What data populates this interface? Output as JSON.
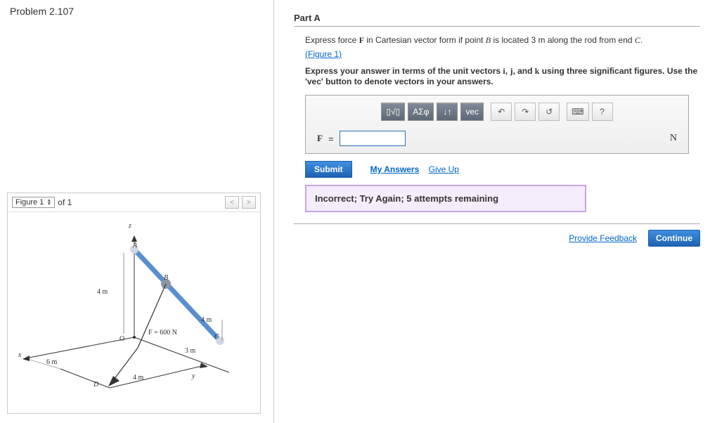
{
  "problem": {
    "title": "Problem 2.107"
  },
  "figure": {
    "selector": "Figure 1",
    "count_label": "of 1",
    "labels": {
      "z": "z",
      "A": "A",
      "B": "B",
      "O": "O",
      "C": "C",
      "D": "D",
      "x": "x",
      "y": "y",
      "dim4m_top": "4 m",
      "dim4m_right": "4 m",
      "dim3m": "3 m",
      "dim4m_bottom": "4 m",
      "dim6m": "6 m",
      "force": "F = 600 N"
    }
  },
  "partA": {
    "heading": "Part A",
    "prompt_pre": "Express force ",
    "F": "F",
    "prompt_mid": " in Cartesian vector form if point ",
    "B": "B",
    "prompt_post": " is located 3 m along the rod from end ",
    "C": "C",
    "period": ".",
    "figure_link": "(Figure 1)",
    "instruction_pre": "Express your answer in terms of the unit vectors ",
    "i": "i",
    "comma1": ", ",
    "j": "j",
    "comma2": ", and ",
    "k": "k",
    "instruction_post": " using three significant figures. Use the 'vec' button to denote vectors in your answers."
  },
  "toolbar": {
    "template": "▯√▯",
    "greek": "ΑΣφ",
    "updown": "↓↑",
    "vec": "vec",
    "undo": "↶",
    "redo": "↷",
    "reset": "↺",
    "keyboard": "⌨",
    "help": "?"
  },
  "answer": {
    "lhs": "F",
    "equals": "=",
    "value": "",
    "unit": "N"
  },
  "actions": {
    "submit": "Submit",
    "my_answers": "My Answers",
    "give_up": "Give Up",
    "provide_feedback": "Provide Feedback",
    "continue": "Continue"
  },
  "feedback": {
    "message": "Incorrect; Try Again; 5 attempts remaining"
  }
}
